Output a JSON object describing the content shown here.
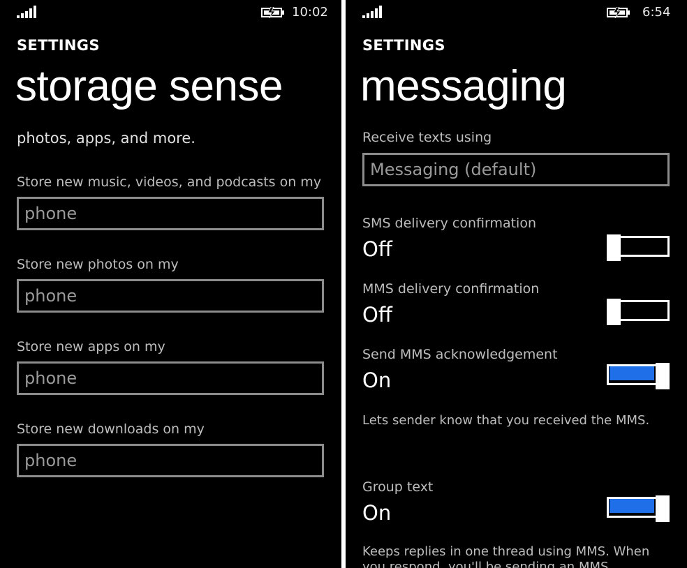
{
  "left": {
    "status": {
      "time": "10:02",
      "signal_icon": "signal-icon",
      "battery_icon": "battery-charging-icon"
    },
    "section": "SETTINGS",
    "title": "storage sense",
    "clipped_text": "photos, apps, and more.",
    "fields": [
      {
        "label": "Store new music, videos, and podcasts on my",
        "value": "phone"
      },
      {
        "label": "Store new photos on my",
        "value": "phone"
      },
      {
        "label": "Store new apps on my",
        "value": "phone"
      },
      {
        "label": "Store new downloads on my",
        "value": "phone"
      }
    ]
  },
  "right": {
    "status": {
      "time": "6:54",
      "signal_icon": "signal-icon",
      "battery_icon": "battery-charging-icon"
    },
    "section": "SETTINGS",
    "title": "messaging",
    "receive": {
      "label": "Receive texts using",
      "value": "Messaging (default)"
    },
    "toggles": [
      {
        "label": "SMS delivery confirmation",
        "value": "Off",
        "state": "off"
      },
      {
        "label": "MMS delivery confirmation",
        "value": "Off",
        "state": "off"
      },
      {
        "label": "Send MMS acknowledgement",
        "value": "On",
        "state": "on",
        "description": "Lets sender know that you received the MMS."
      },
      {
        "label": "Group text",
        "value": "On",
        "state": "on",
        "description": "Keeps replies in one thread using MMS. When",
        "description2": "you respond, you'll be sending an MMS."
      }
    ],
    "accent": "#1e6fe8"
  }
}
